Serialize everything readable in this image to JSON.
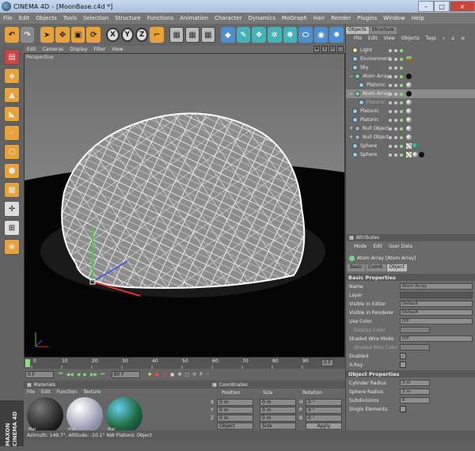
{
  "app": {
    "name": "CINEMA 4D",
    "doc": "[MoonBase.c4d *]"
  },
  "window_controls": {
    "min": "–",
    "max": "□",
    "close": "×"
  },
  "menu": [
    "File",
    "Edit",
    "Objects",
    "Tools",
    "Selection",
    "Structure",
    "Functions",
    "Animation",
    "Character",
    "Dynamics",
    "MoGraph",
    "Hair",
    "Render",
    "Plugins",
    "Window",
    "Help"
  ],
  "toolbar": {
    "axis_x": "X",
    "axis_y": "Y",
    "axis_z": "Z"
  },
  "viewport": {
    "menu": [
      "Edit",
      "Cameras",
      "Display",
      "Filter",
      "View"
    ],
    "label": "Perspective"
  },
  "timeline": {
    "ticks": [
      "0",
      "10",
      "20",
      "30",
      "40",
      "50",
      "60",
      "70",
      "80",
      "90"
    ],
    "end_marker": "0 F"
  },
  "transport": {
    "current": "0 F",
    "end": "90 F"
  },
  "materials": {
    "title": "Materials",
    "menu": [
      "File",
      "Edit",
      "Function",
      "Texture"
    ],
    "items": [
      "Mat",
      "Mat",
      "Mat"
    ]
  },
  "coordinates": {
    "title": "Coordinates",
    "headers": [
      "Position",
      "Size",
      "Rotation"
    ],
    "rows": [
      {
        "axis": "X",
        "pos": "0 m",
        "size": "0 m",
        "rot_axis": "H",
        "rot": "0 °"
      },
      {
        "axis": "Y",
        "pos": "0 m",
        "size": "0 m",
        "rot_axis": "P",
        "rot": "0 °"
      },
      {
        "axis": "Z",
        "pos": "0 m",
        "size": "0 m",
        "rot_axis": "B",
        "rot": "0 °"
      }
    ],
    "mode_left": "Object",
    "mode_mid": "Size",
    "apply": "Apply"
  },
  "status": "Azimuth: 149.7°, Altitude: -10.1°  NW   Platonic Object",
  "maxon": "MAXON CINEMA 4D",
  "objects_panel": {
    "tabs": [
      "Objects",
      "Structure"
    ],
    "menu": [
      "File",
      "Edit",
      "View",
      "Objects",
      "Tags"
    ],
    "items": [
      {
        "name": "Light",
        "indent": 0
      },
      {
        "name": "Environment",
        "indent": 0
      },
      {
        "name": "Sky",
        "indent": 0
      },
      {
        "name": "Atom Array",
        "indent": 0
      },
      {
        "name": "Platonic",
        "indent": 1
      },
      {
        "name": "Atom Array",
        "indent": 0
      },
      {
        "name": "Platonic",
        "indent": 1
      },
      {
        "name": "Platonic",
        "indent": 0
      },
      {
        "name": "Platonic",
        "indent": 0
      },
      {
        "name": "Null Object",
        "indent": 0
      },
      {
        "name": "Null Object",
        "indent": 0
      },
      {
        "name": "Sphere",
        "indent": 0
      },
      {
        "name": "Sphere",
        "indent": 0
      }
    ]
  },
  "attributes": {
    "title": "Attributes",
    "menu": [
      "Mode",
      "Edit",
      "User Data"
    ],
    "object_title": "Atom Array [Atom Array]",
    "tabs": [
      "Basic",
      "Coord.",
      "Object"
    ],
    "basic_header": "Basic Properties",
    "basic": [
      {
        "label": "Name",
        "value": "Atom Array"
      },
      {
        "label": "Layer",
        "value": ""
      },
      {
        "label": "Visible in Editor",
        "value": "Default"
      },
      {
        "label": "Visible in Renderer",
        "value": "Default"
      },
      {
        "label": "Use Color",
        "value": "Off"
      },
      {
        "label": "Display Color",
        "value": ""
      },
      {
        "label": "Shaded Wire Mode",
        "value": "Off"
      },
      {
        "label": "Shaded Wire Color",
        "value": ""
      },
      {
        "label": "Enabled",
        "value": "✓"
      },
      {
        "label": "X-Ray",
        "value": ""
      }
    ],
    "object_header": "Object Properties",
    "object": [
      {
        "label": "Cylinder Radius",
        "value": "3 m"
      },
      {
        "label": "Sphere Radius",
        "value": "3 m"
      },
      {
        "label": "Subdivisions",
        "value": "8"
      },
      {
        "label": "Single Elements",
        "value": ""
      }
    ]
  },
  "colors": {
    "accent": "#e8a23a",
    "panel": "#6a6a6a",
    "titlebar": "#b5c8e2"
  }
}
